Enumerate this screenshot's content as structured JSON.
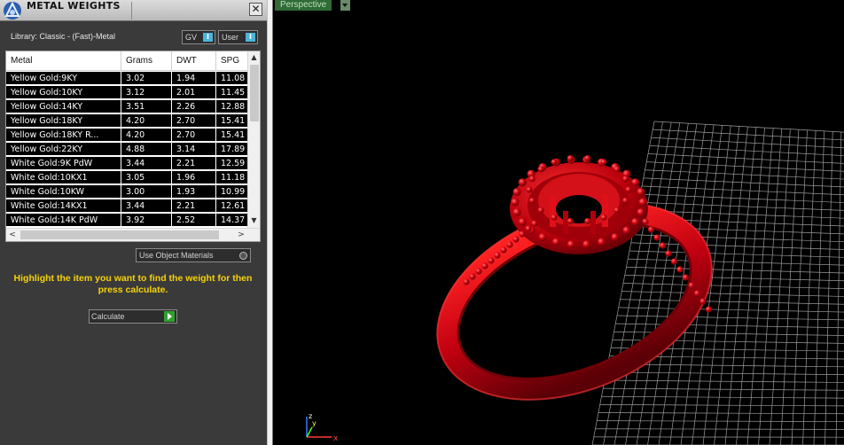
{
  "panel": {
    "title": "METAL WEIGHTS",
    "close_glyph": "✕",
    "library_label": "Library: Classic - (Fast)-Metal",
    "unit_buttons": [
      {
        "label": "GV",
        "toggle": "I"
      },
      {
        "label": "User",
        "toggle": "I"
      }
    ],
    "table": {
      "columns": [
        "Metal",
        "Grams",
        "DWT",
        "SPG"
      ],
      "rows": [
        [
          "Yellow Gold:9KY",
          "3.02",
          "1.94",
          "11.08"
        ],
        [
          "Yellow Gold:10KY",
          "3.12",
          "2.01",
          "11.45"
        ],
        [
          "Yellow Gold:14KY",
          "3.51",
          "2.26",
          "12.88"
        ],
        [
          "Yellow Gold:18KY",
          "4.20",
          "2.70",
          "15.41"
        ],
        [
          "Yellow Gold:18KY R...",
          "4.20",
          "2.70",
          "15.41"
        ],
        [
          "Yellow Gold:22KY",
          "4.88",
          "3.14",
          "17.89"
        ],
        [
          "White Gold:9K PdW",
          "3.44",
          "2.21",
          "12.59"
        ],
        [
          "White Gold:10KX1",
          "3.05",
          "1.96",
          "11.18"
        ],
        [
          "White Gold:10KW",
          "3.00",
          "1.93",
          "10.99"
        ],
        [
          "White Gold:14KX1",
          "3.44",
          "2.21",
          "12.61"
        ],
        [
          "White Gold:14K PdW",
          "3.92",
          "2.52",
          "14.37"
        ]
      ]
    },
    "scroll_glyphs": {
      "up": "▲",
      "down": "▼",
      "left": "<",
      "right": ">"
    },
    "use_object_materials_label": "Use Object Materials",
    "instruction": "Highlight the item you want to find the weight for then press calculate.",
    "calculate_label": "Calculate"
  },
  "viewport": {
    "view_label": "Perspective",
    "axis_labels": {
      "x": "x",
      "y": "y",
      "z": "z"
    },
    "model_color": "#c8000c",
    "grid_color": "#9a9a9a"
  }
}
